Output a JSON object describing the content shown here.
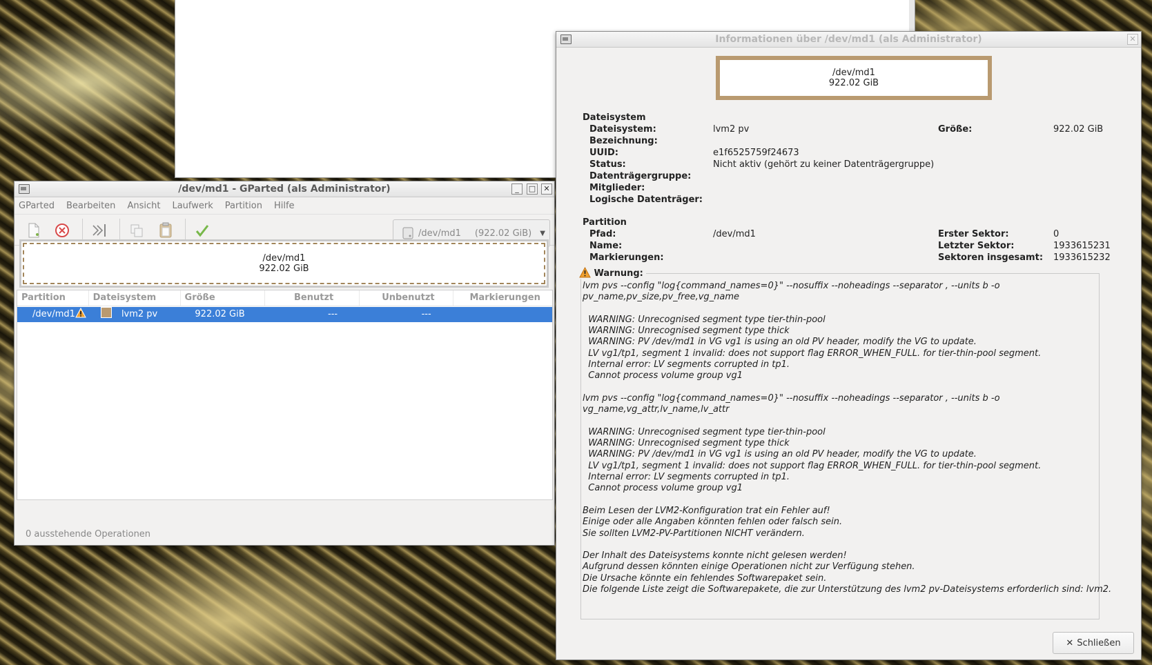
{
  "gparted": {
    "title": "/dev/md1 - GParted (als Administrator)",
    "window_buttons": {
      "minimize": "_",
      "maximize": "□",
      "close": "✕"
    },
    "menu": [
      "GParted",
      "Bearbeiten",
      "Ansicht",
      "Laufwerk",
      "Partition",
      "Hilfe"
    ],
    "device_combo": {
      "device": "/dev/md1",
      "size": "(922.02 GiB)"
    },
    "diskmap": {
      "device": "/dev/md1",
      "size": "922.02 GiB"
    },
    "columns": [
      "Partition",
      "Dateisystem",
      "Größe",
      "Benutzt",
      "Unbenutzt",
      "Markierungen"
    ],
    "row": {
      "partition": "/dev/md1",
      "filesystem": "lvm2 pv",
      "size": "922.02 GiB",
      "used": "---",
      "unused": "---",
      "flags": "",
      "fs_color": "#b99a70"
    },
    "status": "0 ausstehende Operationen"
  },
  "info": {
    "title": "Informationen über /dev/md1 (als Administrator)",
    "box": {
      "device": "/dev/md1",
      "size": "922.02 GiB"
    },
    "fs_section": "Dateisystem",
    "fs_labels": [
      "Dateisystem:",
      "Bezeichnung:",
      "UUID:",
      "Status:",
      "Datenträgergruppe:",
      "Mitglieder:",
      "Logische Datenträger:"
    ],
    "fs_values": [
      "lvm2 pv",
      "",
      "e1f6525759f24673",
      "Nicht aktiv (gehört zu keiner Datenträgergruppe)",
      "",
      "",
      ""
    ],
    "size_label": "Größe:",
    "size_value": "922.02 GiB",
    "part_section": "Partition",
    "part_labels": [
      "Pfad:",
      "Name:",
      "Markierungen:"
    ],
    "part_values": [
      "/dev/md1",
      "",
      ""
    ],
    "sector_labels": [
      "Erster Sektor:",
      "Letzter Sektor:",
      "Sektoren insgesamt:"
    ],
    "sector_values": [
      "0",
      "1933615231",
      "1933615232"
    ],
    "warning_label": "Warnung:",
    "warning_text": "lvm pvs --config \"log{command_names=0}\" --nosuffix --noheadings --separator , --units b -o\npv_name,pv_size,pv_free,vg_name\n\n  WARNING: Unrecognised segment type tier-thin-pool\n  WARNING: Unrecognised segment type thick\n  WARNING: PV /dev/md1 in VG vg1 is using an old PV header, modify the VG to update.\n  LV vg1/tp1, segment 1 invalid: does not support flag ERROR_WHEN_FULL. for tier-thin-pool segment.\n  Internal error: LV segments corrupted in tp1.\n  Cannot process volume group vg1\n\nlvm pvs --config \"log{command_names=0}\" --nosuffix --noheadings --separator , --units b -o\nvg_name,vg_attr,lv_name,lv_attr\n\n  WARNING: Unrecognised segment type tier-thin-pool\n  WARNING: Unrecognised segment type thick\n  WARNING: PV /dev/md1 in VG vg1 is using an old PV header, modify the VG to update.\n  LV vg1/tp1, segment 1 invalid: does not support flag ERROR_WHEN_FULL. for tier-thin-pool segment.\n  Internal error: LV segments corrupted in tp1.\n  Cannot process volume group vg1\n\nBeim Lesen der LVM2-Konfiguration trat ein Fehler auf!\nEinige oder alle Angaben könnten fehlen oder falsch sein.\nSie sollten LVM2-PV-Partitionen NICHT verändern.\n\nDer Inhalt des Dateisystems konnte nicht gelesen werden!\nAufgrund dessen könnten einige Operationen nicht zur Verfügung stehen.\nDie Ursache könnte ein fehlendes Softwarepaket sein.\nDie folgende Liste zeigt die Softwarepakete, die zur Unterstützung des lvm2 pv-Dateisystems erforderlich sind: lvm2.",
    "close_button": "Schließen"
  }
}
